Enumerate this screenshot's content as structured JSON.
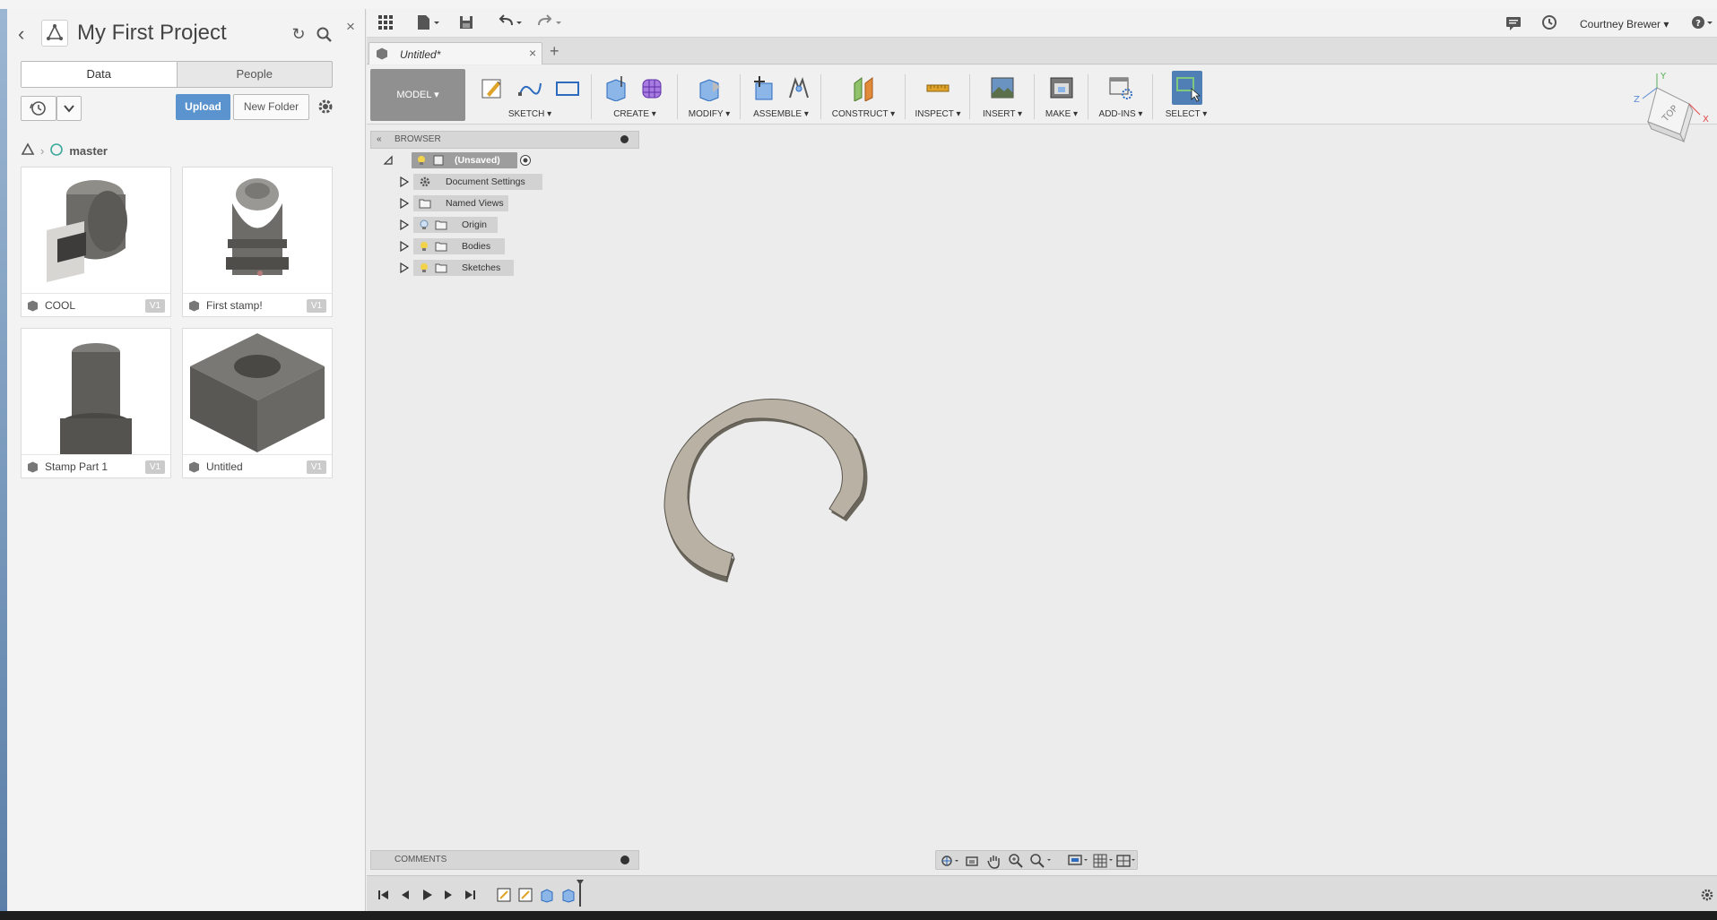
{
  "data_panel": {
    "project_title": "My First Project",
    "tabs": [
      "Data",
      "People"
    ],
    "upload_label": "Upload",
    "new_folder_label": "New Folder",
    "breadcrumb": "master",
    "items": [
      {
        "name": "COOL",
        "version": "V1",
        "thumb": "cam-part"
      },
      {
        "name": "First stamp!",
        "version": "V1",
        "thumb": "stamp-handle"
      },
      {
        "name": "Stamp Part 1",
        "version": "V1",
        "thumb": "cylinder"
      },
      {
        "name": "Untitled",
        "version": "V1",
        "thumb": "cube-with-hole"
      }
    ]
  },
  "quickbar": {
    "user_name": "Courtney Brewer ▾"
  },
  "document": {
    "tab_title": "Untitled*"
  },
  "toolbar": {
    "workspace": "MODEL ▾",
    "groups": [
      "SKETCH ▾",
      "CREATE ▾",
      "MODIFY ▾",
      "ASSEMBLE ▾",
      "CONSTRUCT ▾",
      "INSPECT ▾",
      "INSERT ▾",
      "MAKE ▾",
      "ADD-INS ▾",
      "SELECT ▾"
    ]
  },
  "browser": {
    "title": "BROWSER",
    "root": "(Unsaved)",
    "nodes": [
      "Document Settings",
      "Named Views",
      "Origin",
      "Bodies",
      "Sketches"
    ]
  },
  "comments": {
    "title": "COMMENTS"
  },
  "viewcube": {
    "face": "TOP",
    "axes": {
      "x": "X",
      "y": "Y",
      "z": "Z"
    }
  },
  "colors": {
    "accent": "#5a93cd",
    "select_active": "#4f7fb5",
    "model_body": "#b9b2a4"
  }
}
